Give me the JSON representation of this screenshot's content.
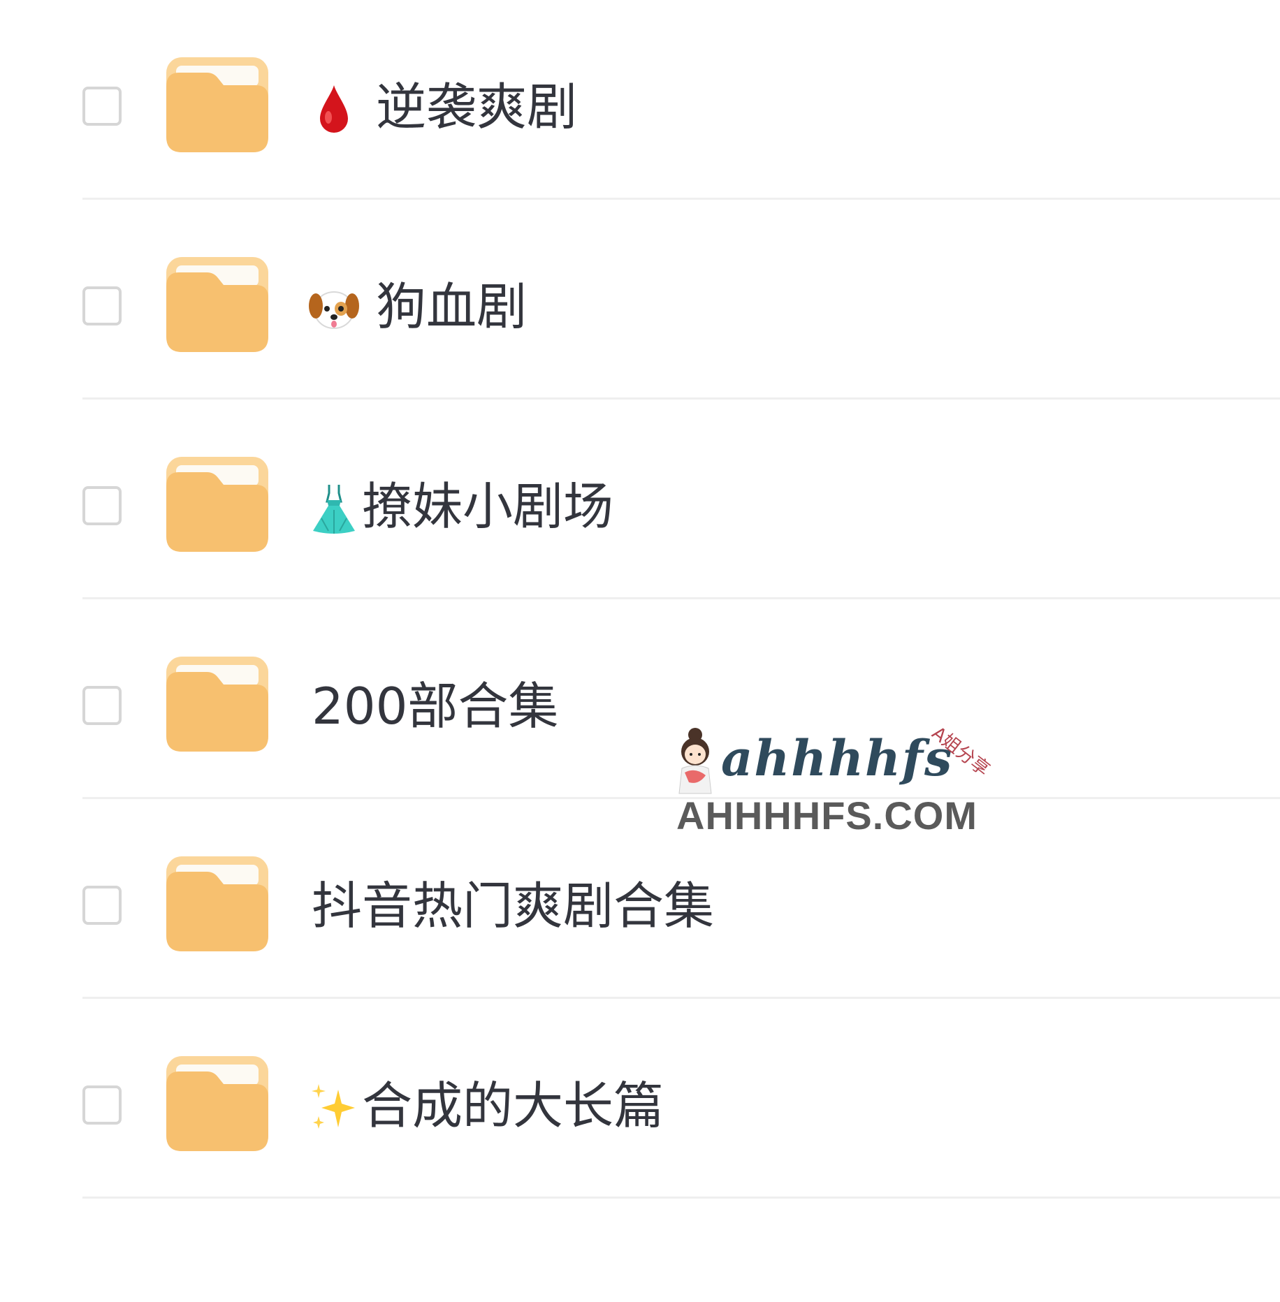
{
  "folders": [
    {
      "emoji": "drop-of-blood-icon",
      "name": "逆袭爽剧"
    },
    {
      "emoji": "dog-face-icon",
      "name": "狗血剧"
    },
    {
      "emoji": "dress-icon",
      "name": "撩妹小剧场"
    },
    {
      "emoji": "",
      "name": "200部合集"
    },
    {
      "emoji": "",
      "name": "抖音热门爽剧合集"
    },
    {
      "emoji": "sparkles-icon",
      "name": "合成的大长篇"
    }
  ],
  "watermark": {
    "logo": "ahhhhfs",
    "tag": "A姐分享",
    "domain": "AHHHHFS.COM"
  },
  "colors": {
    "folder": "#f7c06f",
    "folder_tab": "#fbd69a",
    "text": "#33353d",
    "checkbox_border": "#d6d6d6",
    "divider": "#efefef"
  }
}
